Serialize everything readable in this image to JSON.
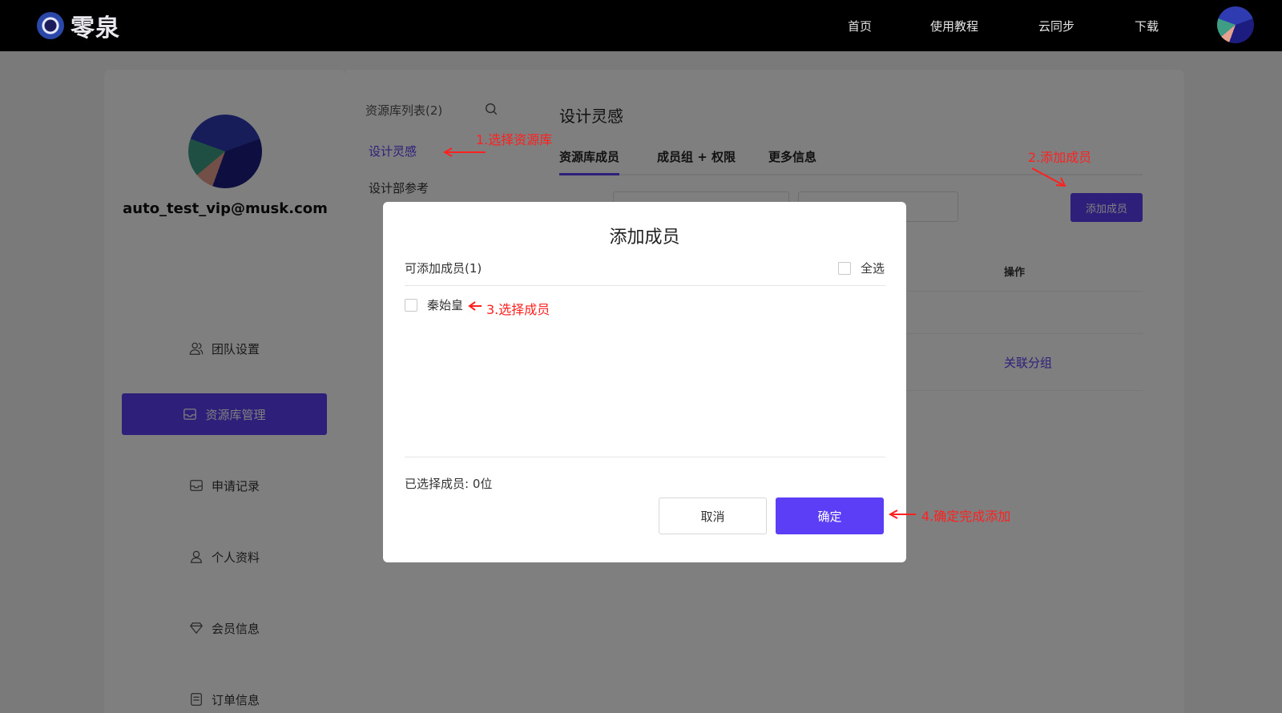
{
  "topbar": {
    "logo_text": "零泉",
    "nav": [
      "首页",
      "使用教程",
      "云同步",
      "下载"
    ]
  },
  "sidebar": {
    "user_email": "auto_test_vip@musk.com",
    "menu": [
      {
        "label": "团队设置",
        "icon": "team-icon",
        "active": false
      },
      {
        "label": "资源库管理",
        "icon": "inbox-icon",
        "active": true
      },
      {
        "label": "申请记录",
        "icon": "inbox-icon",
        "active": false
      },
      {
        "label": "个人资料",
        "icon": "user-icon",
        "active": false
      },
      {
        "label": "会员信息",
        "icon": "diamond-icon",
        "active": false
      },
      {
        "label": "订单信息",
        "icon": "order-icon",
        "active": false
      }
    ]
  },
  "library": {
    "title": "资源库列表(2)",
    "items": [
      "设计灵感",
      "设计部参考"
    ]
  },
  "main": {
    "title": "设计灵感",
    "tabs": [
      "资源库成员",
      "成员组 + 权限",
      "更多信息"
    ],
    "add_button": "添加成员",
    "column_header": "操作",
    "row_link": "关联分组"
  },
  "dialog": {
    "title": "添加成员",
    "available_label": "可添加成员(1)",
    "select_all": "全选",
    "members": [
      "秦始皇"
    ],
    "selected_count": "已选择成员: 0位",
    "cancel": "取消",
    "confirm": "确定"
  },
  "annotations": {
    "step1": "1.选择资源库",
    "step2": "2.添加成员",
    "step3": "3.选择成员",
    "step4": "4.确定完成添加"
  },
  "colors": {
    "accent": "#5b3ef5",
    "annotation": "#ff2020",
    "topbar": "#000000"
  }
}
